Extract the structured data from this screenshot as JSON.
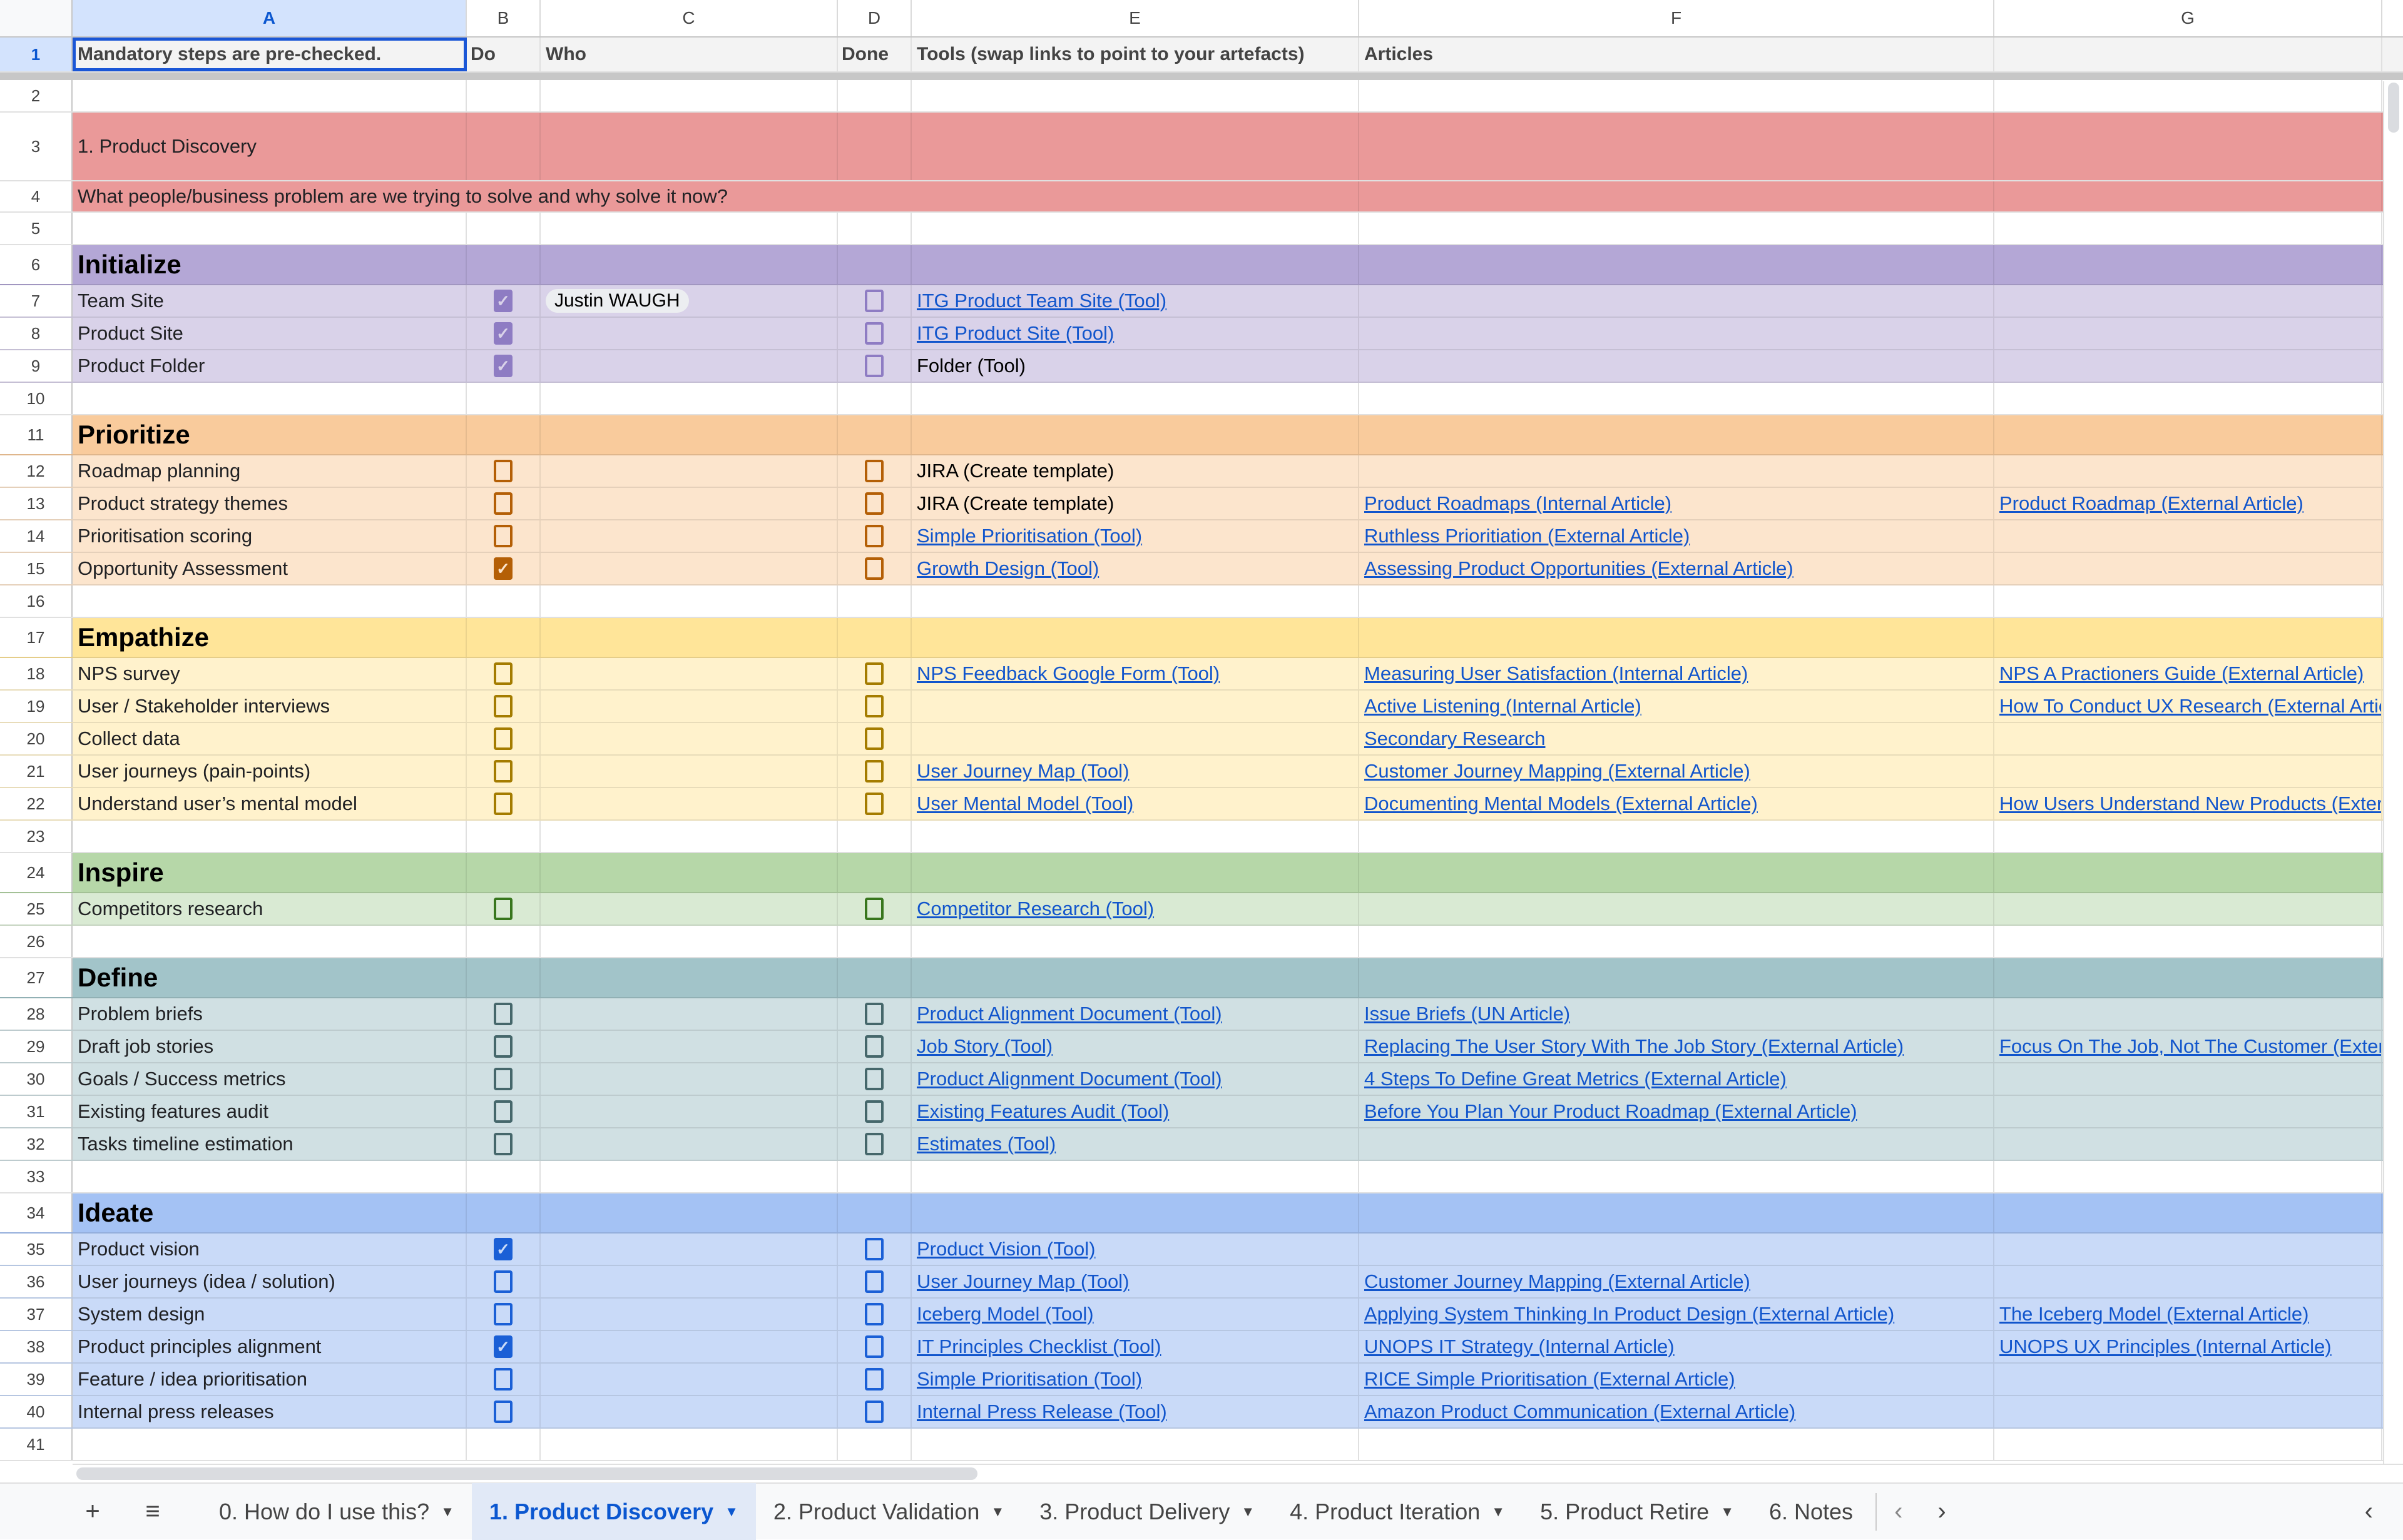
{
  "columns": [
    "A",
    "B",
    "C",
    "D",
    "E",
    "F",
    "G"
  ],
  "selected_cell": "A1",
  "header_row": {
    "row_num": "1",
    "A": "Mandatory steps are pre-checked.",
    "B": "Do",
    "C": "Who",
    "D": "Done",
    "E": "Tools (swap links to point to your artefacts)",
    "F": "Articles",
    "G": ""
  },
  "title": {
    "row_num": "3",
    "text": "1. Product Discovery",
    "subtitle_row_num": "4",
    "subtitle": "What people/business problem are we trying to solve and why solve it now?",
    "color": "#ea9999"
  },
  "sections": [
    {
      "name": "Initialize",
      "row_num": "6",
      "header_color": "#b4a7d6",
      "row_color": "#d9d2e9",
      "checkbox_color": "#8e7cc3",
      "items": [
        {
          "row_num": "7",
          "label": "Team Site",
          "do": true,
          "who": "Justin WAUGH",
          "done": false,
          "tool": "ITG Product Team Site (Tool)",
          "tool_link": true,
          "articles": [
            "",
            ""
          ]
        },
        {
          "row_num": "8",
          "label": "Product Site",
          "do": true,
          "who": "",
          "done": false,
          "tool": "ITG Product Site (Tool)",
          "tool_link": true,
          "articles": [
            "",
            ""
          ]
        },
        {
          "row_num": "9",
          "label": "Product Folder",
          "do": true,
          "who": "",
          "done": false,
          "tool": "Folder (Tool)",
          "tool_link": false,
          "articles": [
            "",
            ""
          ]
        }
      ],
      "blank_after": "10"
    },
    {
      "name": "Prioritize",
      "row_num": "11",
      "header_color": "#f9cb9c",
      "row_color": "#fce5cd",
      "checkbox_color": "#b45f06",
      "items": [
        {
          "row_num": "12",
          "label": "Roadmap planning",
          "do": false,
          "who": "",
          "done": false,
          "tool": "JIRA (Create template)",
          "tool_link": false,
          "articles": [
            "",
            ""
          ]
        },
        {
          "row_num": "13",
          "label": "Product strategy themes",
          "do": false,
          "who": "",
          "done": false,
          "tool": "JIRA (Create template)",
          "tool_link": false,
          "articles": [
            "Product Roadmaps (Internal Article)",
            "Product Roadmap (External Article)"
          ]
        },
        {
          "row_num": "14",
          "label": "Prioritisation scoring",
          "do": false,
          "who": "",
          "done": false,
          "tool": "Simple Prioritisation (Tool)",
          "tool_link": true,
          "articles": [
            "Ruthless Prioritiation (External Article)",
            ""
          ]
        },
        {
          "row_num": "15",
          "label": "Opportunity Assessment",
          "do": true,
          "who": "",
          "done": false,
          "tool": "Growth Design (Tool)",
          "tool_link": true,
          "articles": [
            "Assessing Product Opportunities (External Article)",
            ""
          ]
        }
      ],
      "blank_after": "16"
    },
    {
      "name": "Empathize",
      "row_num": "17",
      "header_color": "#ffe599",
      "row_color": "#fff2cc",
      "checkbox_color": "#a47c00",
      "items": [
        {
          "row_num": "18",
          "label": "NPS survey",
          "do": false,
          "who": "",
          "done": false,
          "tool": "NPS Feedback Google Form (Tool)",
          "tool_link": true,
          "articles": [
            "Measuring User Satisfaction (Internal Article)",
            "NPS A Practioners Guide (External Article)"
          ]
        },
        {
          "row_num": "19",
          "label": "User / Stakeholder interviews",
          "do": false,
          "who": "",
          "done": false,
          "tool": "",
          "tool_link": false,
          "articles": [
            "Active Listening (Internal Article)",
            "How To Conduct UX Research (External Article)"
          ]
        },
        {
          "row_num": "20",
          "label": "Collect data",
          "do": false,
          "who": "",
          "done": false,
          "tool": "",
          "tool_link": false,
          "articles": [
            "Secondary Research",
            ""
          ]
        },
        {
          "row_num": "21",
          "label": "User journeys (pain-points)",
          "do": false,
          "who": "",
          "done": false,
          "tool": "User Journey Map (Tool)",
          "tool_link": true,
          "articles": [
            "Customer Journey Mapping (External Article)",
            ""
          ]
        },
        {
          "row_num": "22",
          "label": "Understand user’s mental model",
          "do": false,
          "who": "",
          "done": false,
          "tool": "User Mental Model (Tool)",
          "tool_link": true,
          "articles": [
            "Documenting Mental Models (External Article)",
            "How Users Understand New Products (External Article)"
          ]
        }
      ],
      "blank_after": "23"
    },
    {
      "name": "Inspire",
      "row_num": "24",
      "header_color": "#b6d7a8",
      "row_color": "#d9ead3",
      "checkbox_color": "#38761d",
      "items": [
        {
          "row_num": "25",
          "label": "Competitors research",
          "do": false,
          "who": "",
          "done": false,
          "tool": "Competitor Research (Tool)",
          "tool_link": true,
          "articles": [
            "",
            ""
          ]
        }
      ],
      "blank_after": "26"
    },
    {
      "name": "Define",
      "row_num": "27",
      "header_color": "#a2c4c9",
      "row_color": "#d0e0e3",
      "checkbox_color": "#45676b",
      "items": [
        {
          "row_num": "28",
          "label": "Problem briefs",
          "do": false,
          "who": "",
          "done": false,
          "tool": "Product Alignment Document (Tool)",
          "tool_link": true,
          "articles": [
            "Issue Briefs (UN Article)",
            ""
          ]
        },
        {
          "row_num": "29",
          "label": "Draft job stories",
          "do": false,
          "who": "",
          "done": false,
          "tool": "Job Story (Tool)",
          "tool_link": true,
          "articles": [
            "Replacing The User Story With The Job Story (External Article)",
            "Focus On The Job, Not The Customer (External Article)"
          ]
        },
        {
          "row_num": "30",
          "label": "Goals / Success metrics",
          "do": false,
          "who": "",
          "done": false,
          "tool": "Product Alignment Document (Tool)",
          "tool_link": true,
          "articles": [
            "4 Steps To Define Great Metrics (External Article)",
            ""
          ]
        },
        {
          "row_num": "31",
          "label": "Existing features audit",
          "do": false,
          "who": "",
          "done": false,
          "tool": "Existing Features Audit (Tool)",
          "tool_link": true,
          "articles": [
            "Before You Plan Your Product Roadmap (External Article)",
            ""
          ]
        },
        {
          "row_num": "32",
          "label": "Tasks timeline estimation",
          "do": false,
          "who": "",
          "done": false,
          "tool": "Estimates (Tool)",
          "tool_link": true,
          "articles": [
            "",
            ""
          ]
        }
      ],
      "blank_after": "33"
    },
    {
      "name": "Ideate",
      "row_num": "34",
      "header_color": "#a4c2f4",
      "row_color": "#c9daf8",
      "checkbox_color": "#1a5fd6",
      "items": [
        {
          "row_num": "35",
          "label": "Product vision",
          "do": true,
          "who": "",
          "done": false,
          "tool": "Product Vision (Tool)",
          "tool_link": true,
          "articles": [
            "",
            ""
          ]
        },
        {
          "row_num": "36",
          "label": "User journeys (idea / solution)",
          "do": false,
          "who": "",
          "done": false,
          "tool": "User Journey Map (Tool)",
          "tool_link": true,
          "articles": [
            "Customer Journey Mapping (External Article)",
            ""
          ]
        },
        {
          "row_num": "37",
          "label": "System design",
          "do": false,
          "who": "",
          "done": false,
          "tool": "Iceberg Model (Tool)",
          "tool_link": true,
          "articles": [
            "Applying System Thinking In Product Design (External Article)",
            "The Iceberg Model (External Article)"
          ]
        },
        {
          "row_num": "38",
          "label": "Product principles alignment",
          "do": true,
          "who": "",
          "done": false,
          "tool": "IT Principles Checklist (Tool)",
          "tool_link": true,
          "articles": [
            "UNOPS IT Strategy (Internal Article)",
            "UNOPS UX Principles (Internal Article)"
          ]
        },
        {
          "row_num": "39",
          "label": "Feature / idea prioritisation",
          "do": false,
          "who": "",
          "done": false,
          "tool": "Simple Prioritisation (Tool)",
          "tool_link": true,
          "articles": [
            "RICE Simple Prioritisation (External Article)",
            ""
          ]
        },
        {
          "row_num": "40",
          "label": "Internal press releases",
          "do": false,
          "who": "",
          "done": false,
          "tool": "Internal Press Release (Tool)",
          "tool_link": true,
          "articles": [
            "Amazon Product Communication (External Article)",
            ""
          ]
        }
      ],
      "blank_after": "41"
    }
  ],
  "row2_num": "2",
  "row5_num": "5",
  "icons": {
    "add_sheet": "+",
    "all_sheets": "≡",
    "check": "✓",
    "tab_caret": "▼",
    "prev": "‹",
    "next": "›",
    "collapse": "‹"
  },
  "tabs": [
    {
      "label": "0. How do I use this?",
      "active": false,
      "has_menu": true
    },
    {
      "label": "1. Product Discovery",
      "active": true,
      "has_menu": true
    },
    {
      "label": "2. Product Validation",
      "active": false,
      "has_menu": true
    },
    {
      "label": "3. Product Delivery",
      "active": false,
      "has_menu": true
    },
    {
      "label": "4. Product Iteration",
      "active": false,
      "has_menu": true
    },
    {
      "label": "5. Product Retire",
      "active": false,
      "has_menu": true
    },
    {
      "label": "6. Notes",
      "active": false,
      "has_menu": false
    }
  ]
}
